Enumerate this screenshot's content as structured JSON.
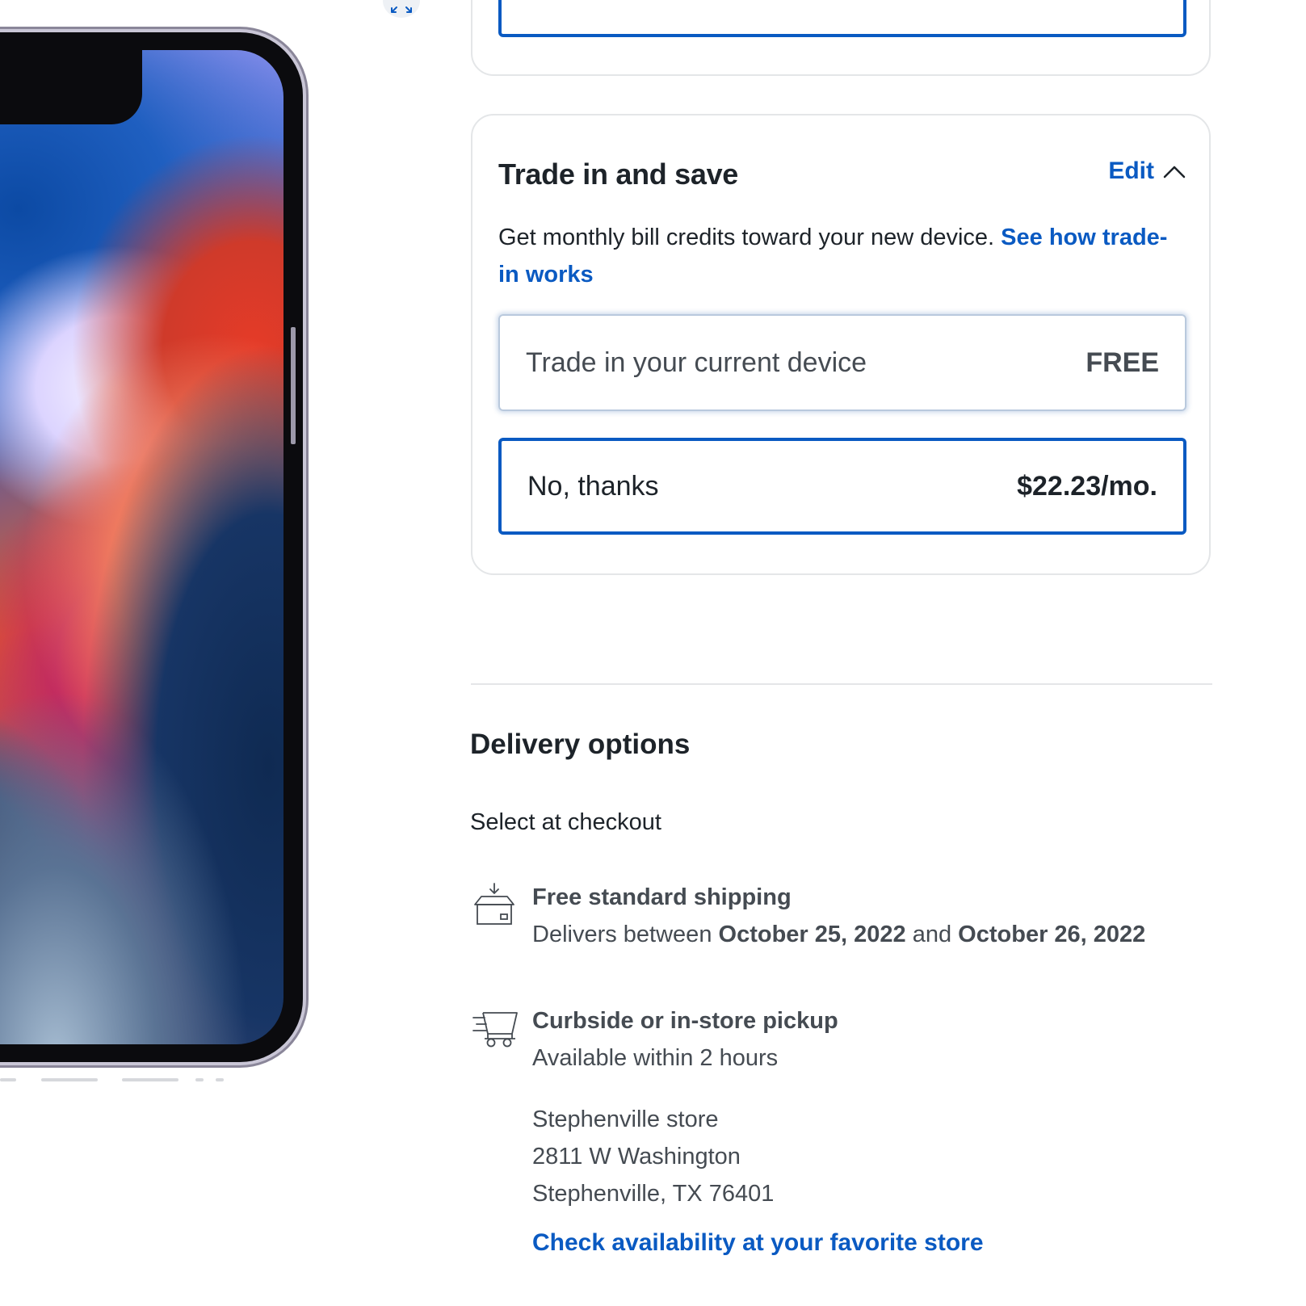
{
  "product_image": {
    "alt": "iPhone front view"
  },
  "gallery": {
    "expand_icon": "expand-arrows-icon",
    "indicator_count": 4
  },
  "trade_in": {
    "title": "Trade in and save",
    "edit_label": "Edit",
    "edit_icon": "chevron-up-icon",
    "description": "Get monthly bill credits toward your new device.",
    "description_link": "See how trade-in works",
    "options": [
      {
        "label": "Trade in your current device",
        "price": "FREE",
        "selected": false
      },
      {
        "label": "No, thanks",
        "price": "$22.23/mo.",
        "selected": true
      }
    ]
  },
  "delivery": {
    "title": "Delivery options",
    "note": "Select at checkout",
    "shipping": {
      "icon": "shipping-box-icon",
      "title": "Free standard shipping",
      "sub_prefix": "Delivers between",
      "date_start": "October 25, 2022",
      "sub_and": "and",
      "date_end": "October 26, 2022"
    },
    "pickup": {
      "icon": "pickup-cart-icon",
      "title": "Curbside or in-store pickup",
      "sub": "Available within 2 hours",
      "store_name": "Stephenville store",
      "store_street": "2811 W Washington",
      "store_city": "Stephenville, TX 76401",
      "check_link": "Check availability at your favorite store"
    }
  },
  "colors": {
    "accent": "#0a5ac2",
    "text": "#1d2329",
    "muted_text": "#454b52",
    "border": "#e4e6e8"
  }
}
